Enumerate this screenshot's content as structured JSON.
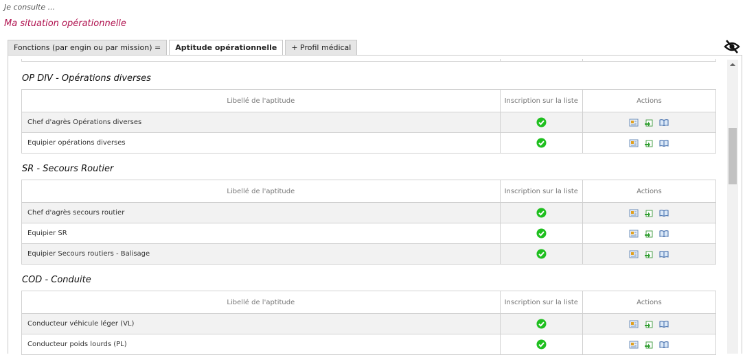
{
  "breadcrumb": "Je consulte ...",
  "page_title": "Ma situation opérationnelle",
  "tabs": [
    {
      "label": "Fonctions (par engin ou par mission) =",
      "active": false
    },
    {
      "label": "Aptitude opérationnelle",
      "active": true
    },
    {
      "label": "+ Profil médical",
      "active": false
    }
  ],
  "toggle_icon": "eye-slash-icon",
  "table_headers": {
    "label": "Libellé de l'aptitude",
    "inscription": "Inscription sur la liste",
    "actions": "Actions"
  },
  "row_icons": [
    "check-circle-icon",
    "card-icon",
    "export-icon",
    "book-icon"
  ],
  "colors": {
    "accent": "#b0124f",
    "ok": "#1fbf1f"
  },
  "sections": [
    {
      "title": "OP DIV - Opérations diverses",
      "rows": [
        {
          "label": "Chef d'agrès Opérations diverses"
        },
        {
          "label": "Equipier opérations diverses"
        }
      ]
    },
    {
      "title": "SR - Secours Routier",
      "rows": [
        {
          "label": "Chef d'agrès secours routier"
        },
        {
          "label": "Equipier SR"
        },
        {
          "label": "Equipier Secours routiers - Balisage"
        }
      ]
    },
    {
      "title": "COD - Conduite",
      "rows": [
        {
          "label": "Conducteur véhicule léger (VL)"
        },
        {
          "label": "Conducteur poids lourds (PL)"
        }
      ]
    }
  ]
}
